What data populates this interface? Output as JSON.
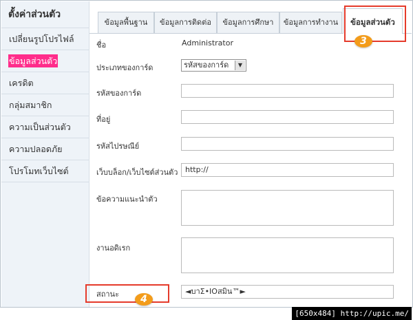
{
  "sidebar": {
    "title": "ตั้งค่าส่วนตัว",
    "items": [
      {
        "label": "เปลี่ยนรูปโปรไฟล์"
      },
      {
        "label": "ข้อมูลส่วนตัว"
      },
      {
        "label": "เครดิต"
      },
      {
        "label": "กลุ่มสมาชิก"
      },
      {
        "label": "ความเป็นส่วนตัว"
      },
      {
        "label": "ความปลอดภัย"
      },
      {
        "label": "โปรโมทเว็บไซต์"
      }
    ]
  },
  "tabs": [
    {
      "label": "ข้อมูลพื้นฐาน"
    },
    {
      "label": "ข้อมูลการติดต่อ"
    },
    {
      "label": "ข้อมูลการศึกษา"
    },
    {
      "label": "ข้อมูลการทำงาน"
    },
    {
      "label": "ข้อมูลส่วนตัว"
    }
  ],
  "callouts": {
    "tab_badge": "3",
    "status_badge": "4"
  },
  "form": {
    "name_label": "ชื่อ",
    "name_value": "Administrator",
    "card_type_label": "ประเภทของการ์ด",
    "card_type_value": "รหัสของการ์ด",
    "card_code_label": "รหัสของการ์ด",
    "address_label": "ที่อยู่",
    "zipcode_label": "รหัสไปรษณีย์",
    "website_label": "เว็บบล็อก/เว็บไซต์ส่วนตัว",
    "website_value": "http://",
    "bio_label": "ข้อความแนะนำตัว",
    "interests_label": "งานอดิเรก",
    "status_label": "สถานะ",
    "status_value": "◄บาΣ•ІОสมิน™►"
  },
  "footer": "[650x484] http://upic.me/",
  "colors": {
    "accent_pink": "#ff2d8b",
    "callout_red": "#e53a2a",
    "badge_orange": "#f39c1b"
  }
}
